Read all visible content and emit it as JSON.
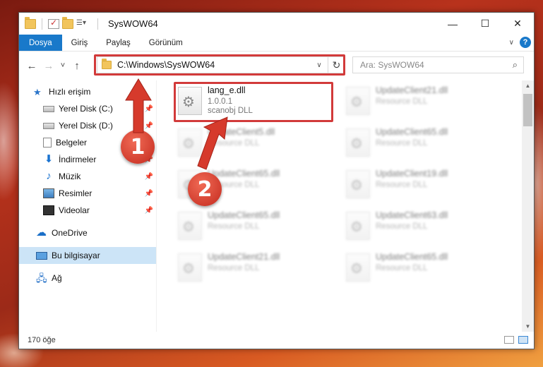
{
  "window": {
    "title": "SysWOW64",
    "controls": {
      "minimize": "—",
      "maximize": "☐",
      "close": "✕"
    }
  },
  "ribbon": {
    "tabs": [
      "Dosya",
      "Giriş",
      "Paylaş",
      "Görünüm"
    ],
    "help": "?"
  },
  "nav": {
    "back": "←",
    "forward": "→",
    "recent": "˅",
    "up": "↑",
    "address": "C:\\Windows\\SysWOW64",
    "address_dropdown": "∨",
    "refresh": "↻",
    "search_placeholder": "Ara: SysWOW64",
    "search_icon": "⌕"
  },
  "sidebar": {
    "items": [
      {
        "label": "Hızlı erişim",
        "icon": "star-icon",
        "pinned": false
      },
      {
        "label": "Yerel Disk (C:)",
        "icon": "disk-icon",
        "pinned": true
      },
      {
        "label": "Yerel Disk (D:)",
        "icon": "disk-icon",
        "pinned": true
      },
      {
        "label": "Belgeler",
        "icon": "document-icon",
        "pinned": true
      },
      {
        "label": "İndirmeler",
        "icon": "download-icon",
        "pinned": true
      },
      {
        "label": "Müzik",
        "icon": "music-icon",
        "pinned": true
      },
      {
        "label": "Resimler",
        "icon": "pictures-icon",
        "pinned": true
      },
      {
        "label": "Videolar",
        "icon": "video-icon",
        "pinned": true
      },
      {
        "label": "OneDrive",
        "icon": "cloud-icon",
        "pinned": false
      },
      {
        "label": "Bu bilgisayar",
        "icon": "computer-icon",
        "pinned": false
      },
      {
        "label": "Ağ",
        "icon": "network-icon",
        "pinned": false
      }
    ],
    "pin_glyph": "📌"
  },
  "files": {
    "highlighted": {
      "name": "lang_e.dll",
      "version": "1.0.0.1",
      "description": "scanobj DLL"
    },
    "blurred": [
      {
        "name": "UpdateClient21.dll",
        "description": "Resource DLL"
      },
      {
        "name": "UpdateClient5.dll",
        "description": "Resource DLL"
      },
      {
        "name": "UpdateClient65.dll",
        "description": "Resource DLL"
      },
      {
        "name": "UpdateClient65.dll",
        "description": "Resource DLL"
      },
      {
        "name": "UpdateClient19.dll",
        "description": "Resource DLL"
      },
      {
        "name": "UpdateClient65.dll",
        "description": "Resource DLL"
      },
      {
        "name": "UpdateClient63.dll",
        "description": "Resource DLL"
      },
      {
        "name": "UpdateClient21.dll",
        "description": "Resource DLL"
      },
      {
        "name": "UpdateClient65.dll",
        "description": "Resource DLL"
      }
    ]
  },
  "status": {
    "count": "170 öğe"
  },
  "callouts": {
    "first": "1",
    "second": "2"
  },
  "colors": {
    "accent": "#1979ca",
    "highlight": "#d23a3a"
  }
}
